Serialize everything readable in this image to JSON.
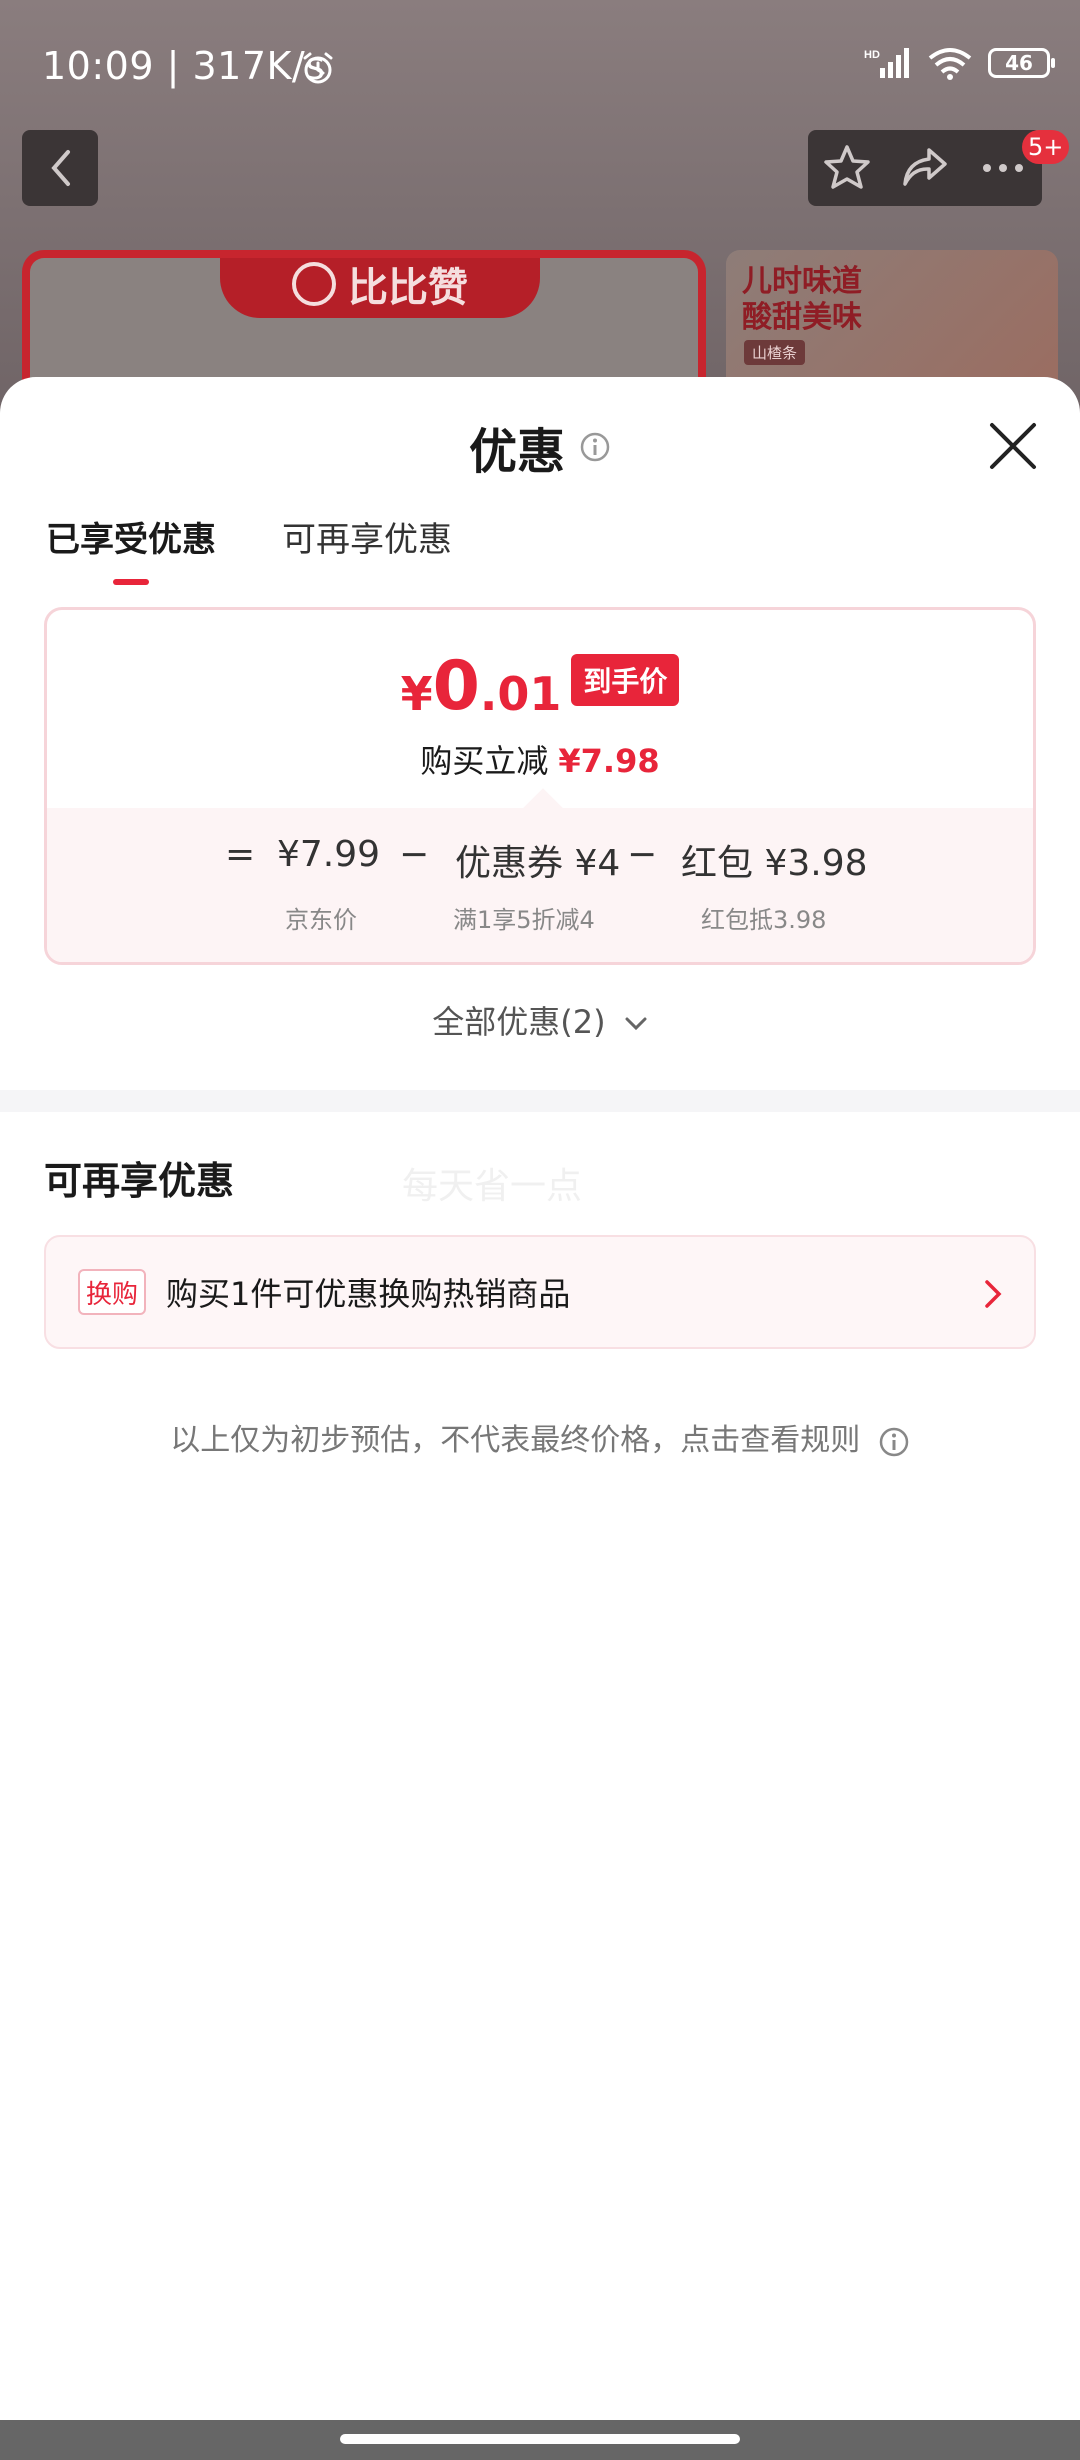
{
  "status_bar": {
    "time": "10:09 | 317K/s",
    "battery": "46"
  },
  "background": {
    "badge": "5+",
    "brand_text": "比比赞",
    "right_banner_title_1": "儿时味道",
    "right_banner_title_2": "酸甜美味",
    "right_banner_tag": "山楂条"
  },
  "sheet": {
    "title": "优惠",
    "tabs": [
      {
        "label": "已享受优惠",
        "active": true
      },
      {
        "label": "可再享优惠",
        "active": false
      }
    ],
    "price_card": {
      "currency": "¥",
      "price_int": "0",
      "price_dec": ".01",
      "final_tag": "到手价",
      "instant_label": "购买立减",
      "instant_amount": "¥7.98",
      "breakdown": {
        "eq": "=",
        "minus": "−",
        "jd_price": "¥7.99",
        "jd_price_label": "京东价",
        "coupon": "优惠券 ¥4",
        "coupon_label": "满1享5折减4",
        "red_packet": "红包 ¥3.98",
        "red_packet_label": "红包抵3.98"
      }
    },
    "all_discounts": "全部优惠(2)",
    "more_section_title": "可再享优惠",
    "watermark": "每天省一点",
    "exchange_badge": "换购",
    "exchange_text": "购买1件可优惠换购热销商品",
    "disclaimer": "以上仅为初步预估，不代表最终价格，点击查看规则"
  },
  "colors": {
    "accent": "#e8253a",
    "card_border": "#f6d4d9",
    "card_bg_tint": "#fdf4f5"
  }
}
